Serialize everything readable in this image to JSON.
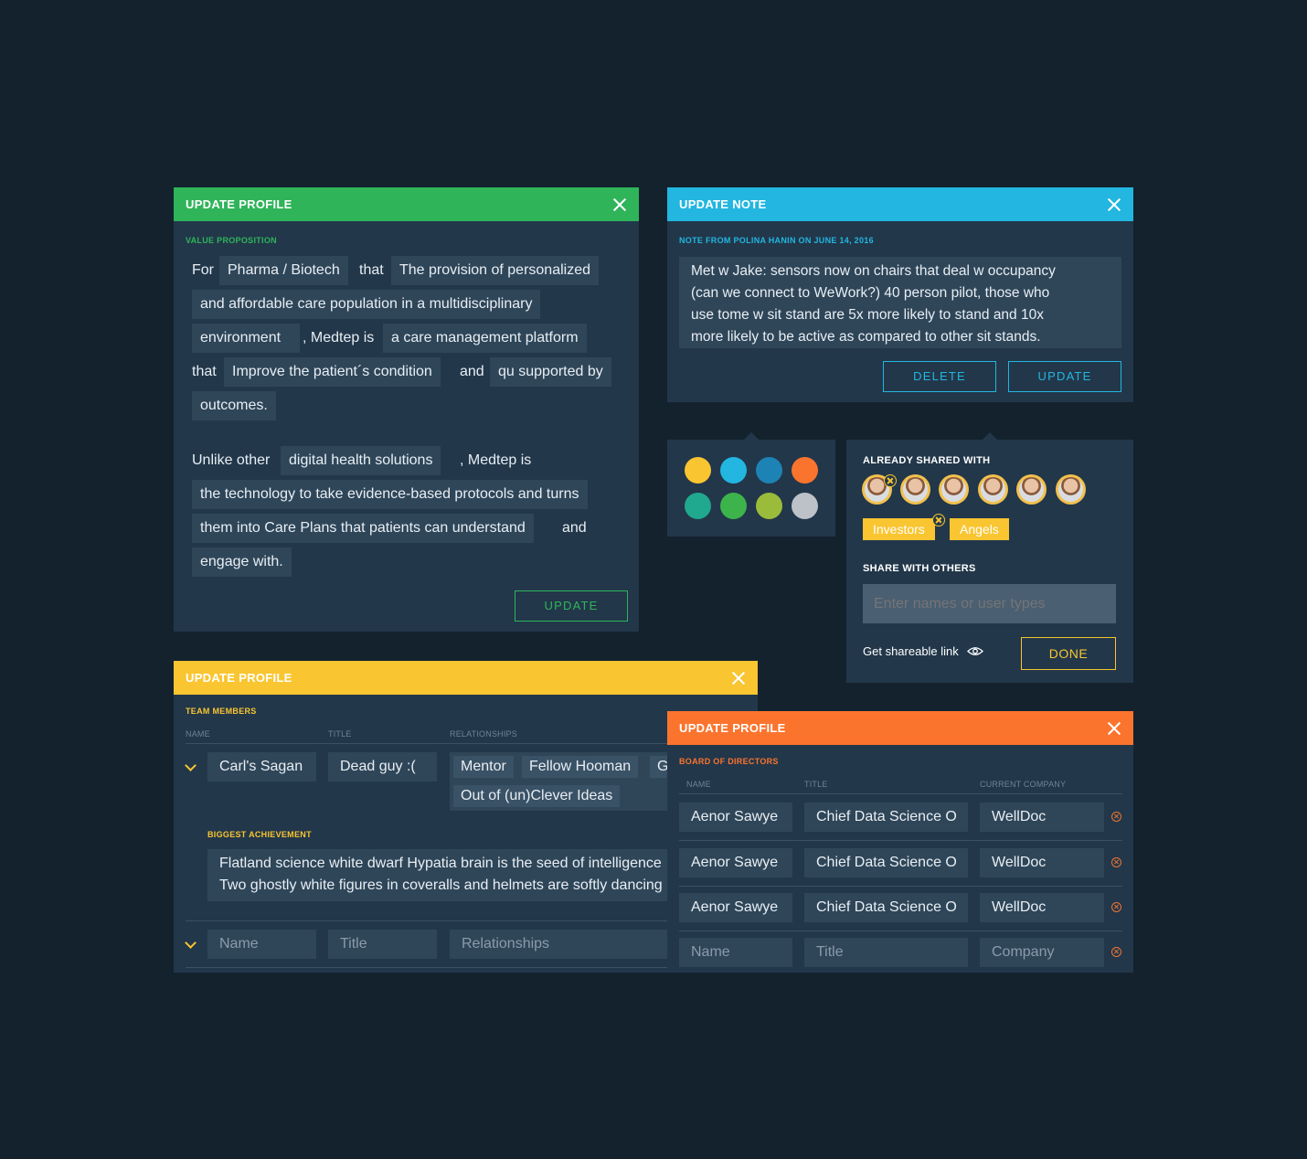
{
  "colors": {
    "green": "#2fb45a",
    "blue": "#22b6e0",
    "yellow": "#f9c531",
    "orange": "#fb742e"
  },
  "value_panel": {
    "title": "UPDATE PROFILE",
    "section": "VALUE PROPOSITION",
    "p1": {
      "for": "For",
      "industry": "Pharma / Biotech",
      "that1": "that",
      "provision_a": "The provision of personalized",
      "provision_b": "and affordable care population in a multidisciplinary",
      "provision_c": "environment",
      "medtep": ", Medtep is",
      "platform": "a care management platform",
      "that2": "that",
      "improve": "Improve the patient´s condition",
      "and": "and",
      "supported": "qu supported by",
      "outcomes": "outcomes."
    },
    "p2": {
      "unlike": "Unlike other",
      "solutions": "digital health solutions",
      "medtep": ", Medtep is",
      "tech_a": "the technology to take evidence-based protocols and turns",
      "tech_b": "them into Care Plans that patients can understand",
      "and": "and",
      "tech_c": "engage with."
    },
    "update_button": "UPDATE"
  },
  "note_panel": {
    "title": "UPDATE NOTE",
    "meta": "NOTE FROM POLINA HANIN ON JUNE 14, 2016",
    "lines": [
      "Met w Jake: sensors now on chairs that deal w occupancy",
      "(can we connect to WeWork?) 40 person pilot, those who",
      "use tome w sit stand are 5x more likely to stand and 10x",
      "more likely to be active as compared to other sit stands."
    ],
    "delete_button": "DELETE",
    "update_button": "UPDATE"
  },
  "color_picker": {
    "swatches": [
      "#f9c531",
      "#22b6e0",
      "#1d83b5",
      "#fb742e",
      "#20a98e",
      "#3cb44b",
      "#9bbc3a",
      "#bcc2c8"
    ]
  },
  "share_panel": {
    "already_label": "ALREADY SHARED WITH",
    "tags": [
      "Investors",
      "Angels"
    ],
    "share_label": "SHARE WITH OTHERS",
    "input_placeholder": "Enter names or user types",
    "link_text": "Get shareable link",
    "done_button": "DONE"
  },
  "team_panel": {
    "title": "UPDATE PROFILE",
    "section": "TEAM MEMBERS",
    "col_name": "NAME",
    "col_title": "TITLE",
    "col_rel": "RELATIONSHIPS",
    "member": {
      "name": "Carl's Sagan",
      "title": "Dead guy :(",
      "relationships": [
        "Mentor",
        "Fellow Hooman",
        "G",
        "Out of (un)Clever Ideas"
      ]
    },
    "achievement_label": "BIGGEST ACHIEVEMENT",
    "achievement_lines": [
      "Flatland science white dwarf Hypatia brain is the seed of intelligence",
      "Two ghostly white figures in coveralls and helmets are softly dancing"
    ],
    "new_row": {
      "name_ph": "Name",
      "title_ph": "Title",
      "rel_ph": "Relationships"
    }
  },
  "board_panel": {
    "title": "UPDATE PROFILE",
    "section": "BOARD OF DIRECTORS",
    "col_name": "NAME",
    "col_title": "TITLE",
    "col_company": "CURRENT COMPANY",
    "rows": [
      {
        "name": "Aenor Sawye",
        "title": "Chief Data Science O",
        "company": "WellDoc"
      },
      {
        "name": "Aenor Sawye",
        "title": "Chief Data Science O",
        "company": "WellDoc"
      },
      {
        "name": "Aenor Sawye",
        "title": "Chief Data Science O",
        "company": "WellDoc"
      }
    ],
    "new_row": {
      "name_ph": "Name",
      "title_ph": "Title",
      "company_ph": "Company"
    }
  }
}
